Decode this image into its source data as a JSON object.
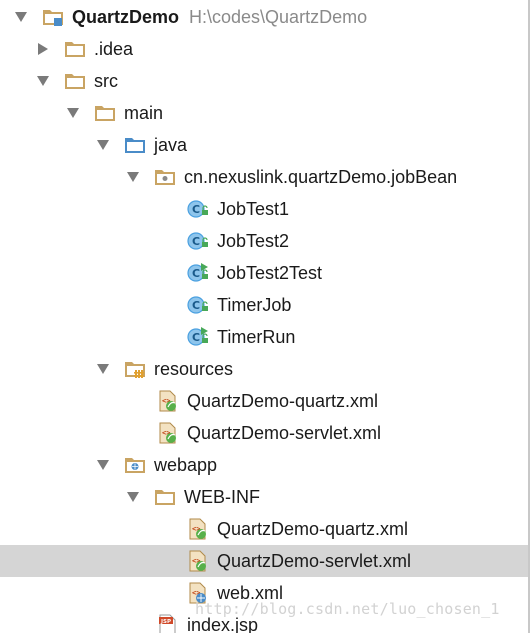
{
  "project": {
    "name": "QuartzDemo",
    "path": "H:\\codes\\QuartzDemo"
  },
  "nodes": {
    "idea": ".idea",
    "src": "src",
    "main": "main",
    "java": "java",
    "package": "cn.nexuslink.quartzDemo.jobBean",
    "jobtest1": "JobTest1",
    "jobtest2": "JobTest2",
    "jobtest2test": "JobTest2Test",
    "timerjob": "TimerJob",
    "timerrun": "TimerRun",
    "resources": "resources",
    "res_quartz": "QuartzDemo-quartz.xml",
    "res_servlet": "QuartzDemo-servlet.xml",
    "webapp": "webapp",
    "webinf": "WEB-INF",
    "wi_quartz": "QuartzDemo-quartz.xml",
    "wi_servlet": "QuartzDemo-servlet.xml",
    "webxml": "web.xml",
    "indexjsp": "index.jsp"
  },
  "watermark": "http://blog.csdn.net/luo_chosen_1",
  "colors": {
    "selection": "#d5d5d5",
    "folder": "#c9a463",
    "source_folder": "#4a8cc8",
    "class_icon": "#4aa0e0",
    "lock_green": "#48a858",
    "path_grey": "#8a8a8a"
  }
}
